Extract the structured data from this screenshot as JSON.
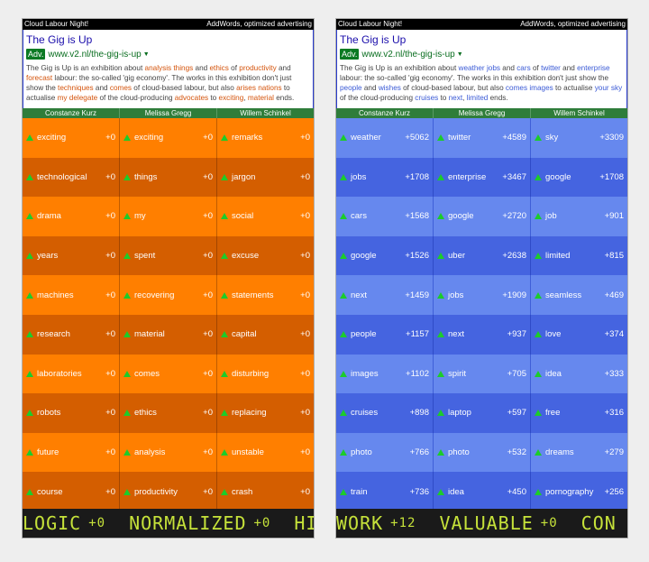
{
  "left": {
    "topbar": {
      "left": "Cloud Labour Night!",
      "right": "AddWords, optimized advertising"
    },
    "ad": {
      "title": "The Gig is Up",
      "badge": "Adv.",
      "url": "www.v2.nl/the-gig-is-up",
      "text": [
        {
          "t": "The Gig is Up is an exhibition about ",
          "h": false
        },
        {
          "t": "analysis",
          "h": true
        },
        {
          "t": " ",
          "h": false
        },
        {
          "t": "things",
          "h": true
        },
        {
          "t": " and ",
          "h": false
        },
        {
          "t": "ethics",
          "h": true
        },
        {
          "t": " of ",
          "h": false
        },
        {
          "t": "productivity",
          "h": true
        },
        {
          "t": " and ",
          "h": false
        },
        {
          "t": "forecast",
          "h": true
        },
        {
          "t": " labour: the so-called 'gig economy'. The works in this exhibition don't just show the ",
          "h": false
        },
        {
          "t": "techniques",
          "h": true
        },
        {
          "t": " and ",
          "h": false
        },
        {
          "t": "comes",
          "h": true
        },
        {
          "t": " of cloud-based labour, but also ",
          "h": false
        },
        {
          "t": "arises",
          "h": true
        },
        {
          "t": " ",
          "h": false
        },
        {
          "t": "nations",
          "h": true
        },
        {
          "t": " to actualise ",
          "h": false
        },
        {
          "t": "my",
          "h": true
        },
        {
          "t": " ",
          "h": false
        },
        {
          "t": "delegate",
          "h": true
        },
        {
          "t": " of the cloud-producing ",
          "h": false
        },
        {
          "t": "advocates",
          "h": true
        },
        {
          "t": " to ",
          "h": false
        },
        {
          "t": "exciting",
          "h": true
        },
        {
          "t": ", ",
          "h": false
        },
        {
          "t": "material",
          "h": true
        },
        {
          "t": " ends.",
          "h": false
        }
      ]
    },
    "headers": [
      "Constanze Kurz",
      "Melissa Gregg",
      "Willem Schinkel"
    ],
    "rows": [
      [
        [
          "exciting",
          "+0"
        ],
        [
          "exciting",
          "+0"
        ],
        [
          "remarks",
          "+0"
        ]
      ],
      [
        [
          "technological",
          "+0"
        ],
        [
          "things",
          "+0"
        ],
        [
          "jargon",
          "+0"
        ]
      ],
      [
        [
          "drama",
          "+0"
        ],
        [
          "my",
          "+0"
        ],
        [
          "social",
          "+0"
        ]
      ],
      [
        [
          "years",
          "+0"
        ],
        [
          "spent",
          "+0"
        ],
        [
          "excuse",
          "+0"
        ]
      ],
      [
        [
          "machines",
          "+0"
        ],
        [
          "recovering",
          "+0"
        ],
        [
          "statements",
          "+0"
        ]
      ],
      [
        [
          "research",
          "+0"
        ],
        [
          "material",
          "+0"
        ],
        [
          "capital",
          "+0"
        ]
      ],
      [
        [
          "laboratories",
          "+0"
        ],
        [
          "comes",
          "+0"
        ],
        [
          "disturbing",
          "+0"
        ]
      ],
      [
        [
          "robots",
          "+0"
        ],
        [
          "ethics",
          "+0"
        ],
        [
          "replacing",
          "+0"
        ]
      ],
      [
        [
          "future",
          "+0"
        ],
        [
          "analysis",
          "+0"
        ],
        [
          "unstable",
          "+0"
        ]
      ],
      [
        [
          "course",
          "+0"
        ],
        [
          "productivity",
          "+0"
        ],
        [
          "crash",
          "+0"
        ]
      ]
    ],
    "ticker": [
      [
        "LOGIC",
        "+0"
      ],
      [
        "NORMALIZED",
        "+0"
      ],
      [
        "HI",
        ""
      ]
    ]
  },
  "right": {
    "topbar": {
      "left": "Cloud Labour Night!",
      "right": "AddWords, optimized advertising"
    },
    "ad": {
      "title": "The Gig is Up",
      "badge": "Adv.",
      "url": "www.v2.nl/the-gig-is-up",
      "text": [
        {
          "t": "The Gig is Up is an exhibition about ",
          "h": false
        },
        {
          "t": "weather",
          "h": true
        },
        {
          "t": " ",
          "h": false
        },
        {
          "t": "jobs",
          "h": true
        },
        {
          "t": " and ",
          "h": false
        },
        {
          "t": "cars",
          "h": true
        },
        {
          "t": " of ",
          "h": false
        },
        {
          "t": "twitter",
          "h": true
        },
        {
          "t": " and ",
          "h": false
        },
        {
          "t": "enterprise",
          "h": true
        },
        {
          "t": " labour: the so-called 'gig economy'. The works in this exhibition don't just show the ",
          "h": false
        },
        {
          "t": "people",
          "h": true
        },
        {
          "t": " and ",
          "h": false
        },
        {
          "t": "wishes",
          "h": true
        },
        {
          "t": " of cloud-based labour, but also ",
          "h": false
        },
        {
          "t": "comes",
          "h": true
        },
        {
          "t": " ",
          "h": false
        },
        {
          "t": "images",
          "h": true
        },
        {
          "t": " to actualise ",
          "h": false
        },
        {
          "t": "your",
          "h": true
        },
        {
          "t": " ",
          "h": false
        },
        {
          "t": "sky",
          "h": true
        },
        {
          "t": " of the cloud-producing ",
          "h": false
        },
        {
          "t": "cruises",
          "h": true
        },
        {
          "t": " to ",
          "h": false
        },
        {
          "t": "next",
          "h": true
        },
        {
          "t": ", ",
          "h": false
        },
        {
          "t": "limited",
          "h": true
        },
        {
          "t": " ends.",
          "h": false
        }
      ]
    },
    "headers": [
      "Constanze Kurz",
      "Melissa Gregg",
      "Willem Schinkel"
    ],
    "rows": [
      [
        [
          "weather",
          "+5062"
        ],
        [
          "twitter",
          "+4589"
        ],
        [
          "sky",
          "+3309"
        ]
      ],
      [
        [
          "jobs",
          "+1708"
        ],
        [
          "enterprise",
          "+3467"
        ],
        [
          "google",
          "+1708"
        ]
      ],
      [
        [
          "cars",
          "+1568"
        ],
        [
          "google",
          "+2720"
        ],
        [
          "job",
          "+901"
        ]
      ],
      [
        [
          "google",
          "+1526"
        ],
        [
          "uber",
          "+2638"
        ],
        [
          "limited",
          "+815"
        ]
      ],
      [
        [
          "next",
          "+1459"
        ],
        [
          "jobs",
          "+1909"
        ],
        [
          "seamless",
          "+469"
        ]
      ],
      [
        [
          "people",
          "+1157"
        ],
        [
          "next",
          "+937"
        ],
        [
          "love",
          "+374"
        ]
      ],
      [
        [
          "images",
          "+1102"
        ],
        [
          "spirit",
          "+705"
        ],
        [
          "idea",
          "+333"
        ]
      ],
      [
        [
          "cruises",
          "+898"
        ],
        [
          "laptop",
          "+597"
        ],
        [
          "free",
          "+316"
        ]
      ],
      [
        [
          "photo",
          "+766"
        ],
        [
          "photo",
          "+532"
        ],
        [
          "dreams",
          "+279"
        ]
      ],
      [
        [
          "train",
          "+736"
        ],
        [
          "idea",
          "+450"
        ],
        [
          "pornography",
          "+256"
        ]
      ]
    ],
    "ticker": [
      [
        "WORK",
        "+12"
      ],
      [
        "VALUABLE",
        "+0"
      ],
      [
        "CON",
        ""
      ]
    ]
  }
}
